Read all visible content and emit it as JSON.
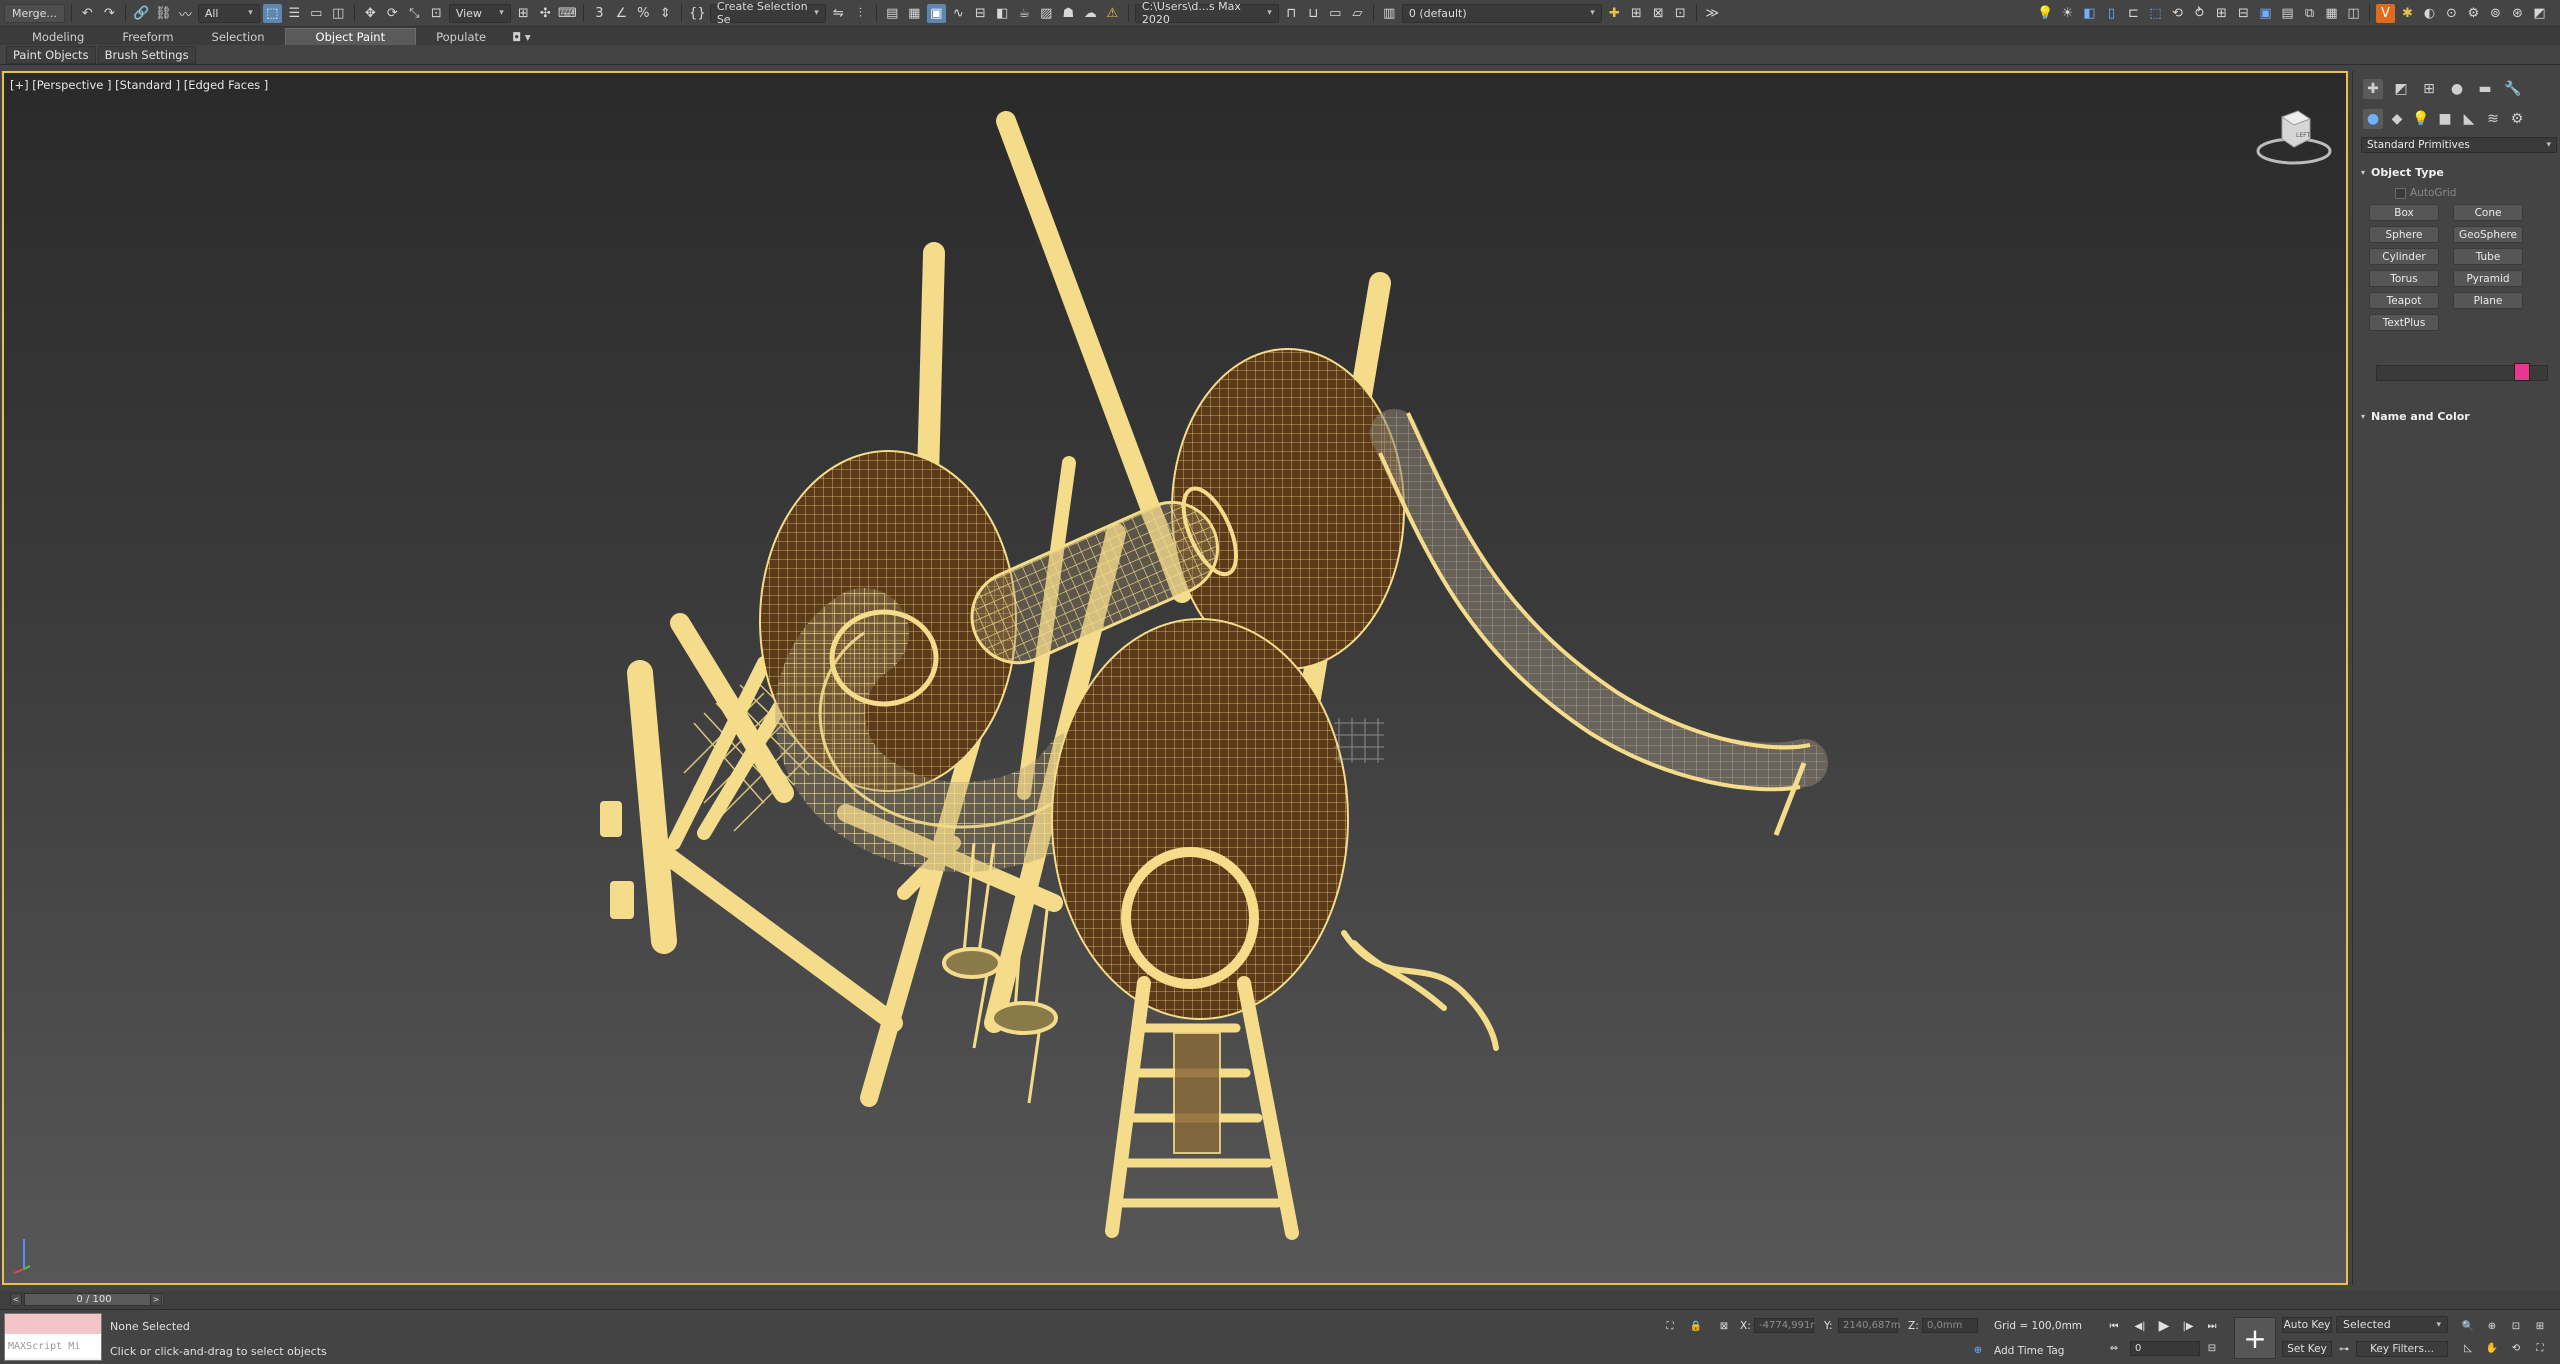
{
  "toolbar": {
    "merge_label": "Merge...",
    "selection_filter": "All",
    "ref_coord": "View",
    "named_selection": "Create Selection Se",
    "project_path": "C:\\Users\\d...s Max 2020",
    "layer": "0 (default)",
    "icons": [
      "undo-icon",
      "redo-icon",
      "link-icon",
      "unlink-icon",
      "bind-space-warp-icon",
      "select-object-icon",
      "select-by-name-icon",
      "rect-region-icon",
      "window-crossing-icon",
      "move-icon",
      "rotate-icon",
      "scale-icon",
      "placement-icon",
      "pivot-icon",
      "select-manipulate-icon",
      "snap-3d-icon",
      "angle-snap-icon",
      "percent-snap-icon",
      "spinner-snap-icon",
      "mirror-icon",
      "align-icon",
      "layer-explorer-icon",
      "scene-explorer-icon",
      "ribbon-toggle-icon",
      "curve-editor-icon",
      "schematic-view-icon",
      "material-editor-icon",
      "render-setup-icon",
      "render-frame-icon",
      "render-icon",
      "render-online-icon",
      "warning-icon"
    ]
  },
  "ribbon": {
    "tabs": [
      "Modeling",
      "Freeform",
      "Selection",
      "Object Paint",
      "Populate"
    ],
    "active_tab": "Object Paint"
  },
  "subtabs": [
    "Paint Objects",
    "Brush Settings"
  ],
  "viewport": {
    "label": "[+] [Perspective ] [Standard ] [Edged Faces ]",
    "viewcube_label": "LEFT"
  },
  "command_panel": {
    "tabs": [
      "create-icon",
      "modify-icon",
      "hierarchy-icon",
      "motion-icon",
      "display-icon",
      "utilities-icon"
    ],
    "category_icons": [
      "geometry-icon",
      "shapes-icon",
      "lights-icon",
      "cameras-icon",
      "helpers-icon",
      "space-warps-icon",
      "systems-icon"
    ],
    "category_dropdown": "Standard Primitives",
    "object_type_title": "Object Type",
    "autogrid_label": "AutoGrid",
    "primitives": [
      "Box",
      "Cone",
      "Sphere",
      "GeoSphere",
      "Cylinder",
      "Tube",
      "Torus",
      "Pyramid",
      "Teapot",
      "Plane",
      "TextPlus"
    ],
    "name_color_title": "Name and Color",
    "object_color": "#e8388e"
  },
  "timeline": {
    "frame_display": "0 / 100",
    "prev_arrow": "<",
    "next_arrow": ">"
  },
  "status": {
    "maxscript_placeholder": "MAXScript Mi",
    "selection_status": "None Selected",
    "prompt": "Click or click-and-drag to select objects",
    "x_label": "X:",
    "x_value": "-4774,991r",
    "y_label": "Y:",
    "y_value": "2140,687m",
    "z_label": "Z:",
    "z_value": "0,0mm",
    "grid": "Grid = 100,0mm",
    "add_time_tag": "Add Time Tag",
    "auto_key": "Auto Key",
    "set_key": "Set Key",
    "selected_dropdown": "Selected",
    "key_filters": "Key Filters...",
    "frame_value": "0"
  },
  "colors": {
    "viewport_border": "#e8c24a",
    "wireframe": "#f5dc8a",
    "egg_fill": "#5a3a18",
    "maxscript_bg": "#f3c5c8"
  }
}
